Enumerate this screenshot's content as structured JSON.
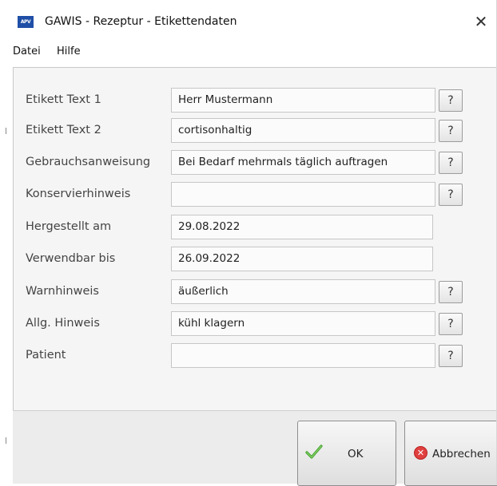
{
  "window": {
    "title": "GAWIS - Rezeptur - Etikettendaten",
    "app_icon_text": "APV",
    "close_glyph": "✕"
  },
  "menu": {
    "items": [
      "Datei",
      "Hilfe"
    ]
  },
  "form": {
    "fields": [
      {
        "label": "Etikett Text 1",
        "value": "Herr Mustermann",
        "has_help": true
      },
      {
        "label": "Etikett Text 2",
        "value": "cortisonhaltig",
        "has_help": true
      },
      {
        "label": "Gebrauchsanweisung",
        "value": "Bei Bedarf mehrmals täglich auftragen",
        "has_help": true
      },
      {
        "label": "Konservierhinweis",
        "value": "",
        "has_help": true
      },
      {
        "label": "Hergestellt am",
        "value": "29.08.2022",
        "has_help": false
      },
      {
        "label": "Verwendbar bis",
        "value": "26.09.2022",
        "has_help": false
      },
      {
        "label": "Warnhinweis",
        "value": "äußerlich",
        "has_help": true
      },
      {
        "label": "Allg. Hinweis",
        "value": "kühl klagern",
        "has_help": true
      },
      {
        "label": "Patient",
        "value": "",
        "has_help": true
      }
    ],
    "help_label": "?"
  },
  "buttons": {
    "ok_label": "OK",
    "cancel_label": "Abbrechen"
  },
  "icons": {
    "ok": "check-icon",
    "cancel": "cancel-icon"
  }
}
